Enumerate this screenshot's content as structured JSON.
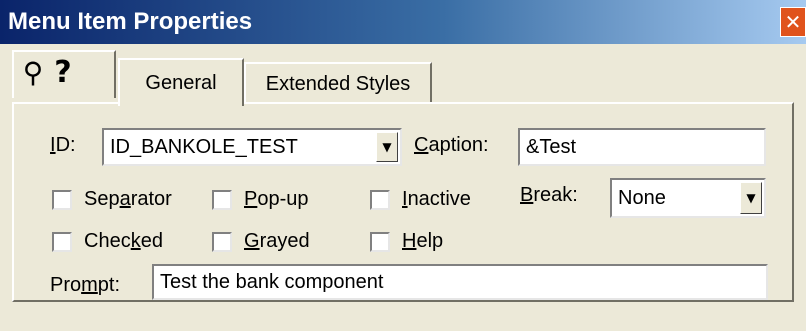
{
  "window": {
    "title": "Menu Item Properties",
    "close_glyph": "✕"
  },
  "toolbar": {
    "pin_icon": "pushpin-icon",
    "help_icon": "question-mark-icon",
    "pin_glyph": "⚲",
    "help_glyph": "?"
  },
  "tabs": [
    {
      "label": "General",
      "selected": true
    },
    {
      "label": "Extended Styles",
      "selected": false
    }
  ],
  "form": {
    "id_label_u": "I",
    "id_label_rest": "D:",
    "id_value": "ID_BANKOLE_TEST",
    "caption_label_u": "C",
    "caption_label_rest": "aption:",
    "caption_value": "&Test",
    "break_label_u": "B",
    "break_label_rest": "reak:",
    "break_value": "None",
    "prompt_label_pre": "Pro",
    "prompt_label_u": "m",
    "prompt_label_post": "pt:",
    "prompt_value": "Test the bank component",
    "checkboxes": [
      {
        "pre": "Sep",
        "u": "a",
        "post": "rator",
        "checked": false
      },
      {
        "pre": "",
        "u": "P",
        "post": "op-up",
        "checked": false
      },
      {
        "pre": "",
        "u": "I",
        "post": "nactive",
        "checked": false
      },
      {
        "pre": "Chec",
        "u": "k",
        "post": "ed",
        "checked": false
      },
      {
        "pre": "",
        "u": "G",
        "post": "rayed",
        "checked": false
      },
      {
        "pre": "",
        "u": "H",
        "post": "elp",
        "checked": false
      }
    ]
  },
  "colors": {
    "title_start": "#0a246a",
    "title_end": "#a6caf0",
    "face": "#ece9d8",
    "close": "#e0531c"
  }
}
